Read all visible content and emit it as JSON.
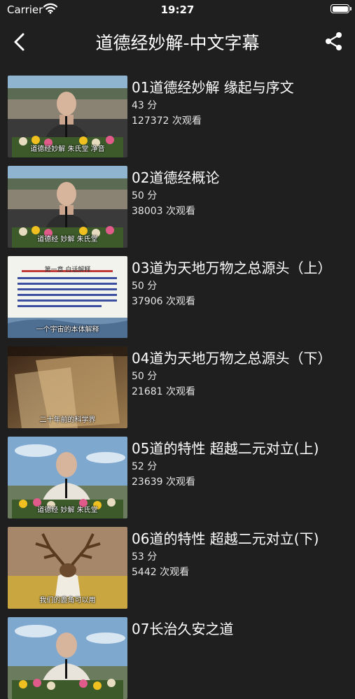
{
  "status_bar": {
    "carrier": "Carrier",
    "time": "19:27"
  },
  "nav": {
    "title": "道德经妙解-中文字幕"
  },
  "videos": [
    {
      "title": "01道德经妙解 缘起与序文",
      "duration": "43 分",
      "views": "127372 次观看",
      "thumb_type": "speaker-stage",
      "caption": "道德经妙解 朱氏堂 净音"
    },
    {
      "title": "02道德经概论",
      "duration": "50 分",
      "views": "38003 次观看",
      "thumb_type": "speaker-stage",
      "caption": "道德经 妙解 朱氏堂"
    },
    {
      "title": "03道为天地万物之总源头（上）",
      "duration": "50 分",
      "views": "37906 次观看",
      "thumb_type": "text-slide",
      "caption": "一个宇宙的本体解释",
      "slide_heading": "第一章 白话解释"
    },
    {
      "title": "04道为天地万物之总源头（下）",
      "duration": "50 分",
      "views": "21681 次观看",
      "thumb_type": "abstract",
      "caption": "二十年前的科学界"
    },
    {
      "title": "05道的特性 超越二元对立(上)",
      "duration": "52 分",
      "views": "23639 次观看",
      "thumb_type": "speaker-sky",
      "caption": "道德经 妙解 朱氏堂"
    },
    {
      "title": "06道的特性 超越二元对立(下)",
      "duration": "53 分",
      "views": "5442 次观看",
      "thumb_type": "deer",
      "caption": "我们的鹿角可以用"
    },
    {
      "title": "07长治久安之道",
      "duration": "",
      "views": "",
      "thumb_type": "speaker-sky",
      "caption": ""
    }
  ],
  "colors": {
    "background": "#1f1f1f",
    "text": "#ffffff"
  }
}
